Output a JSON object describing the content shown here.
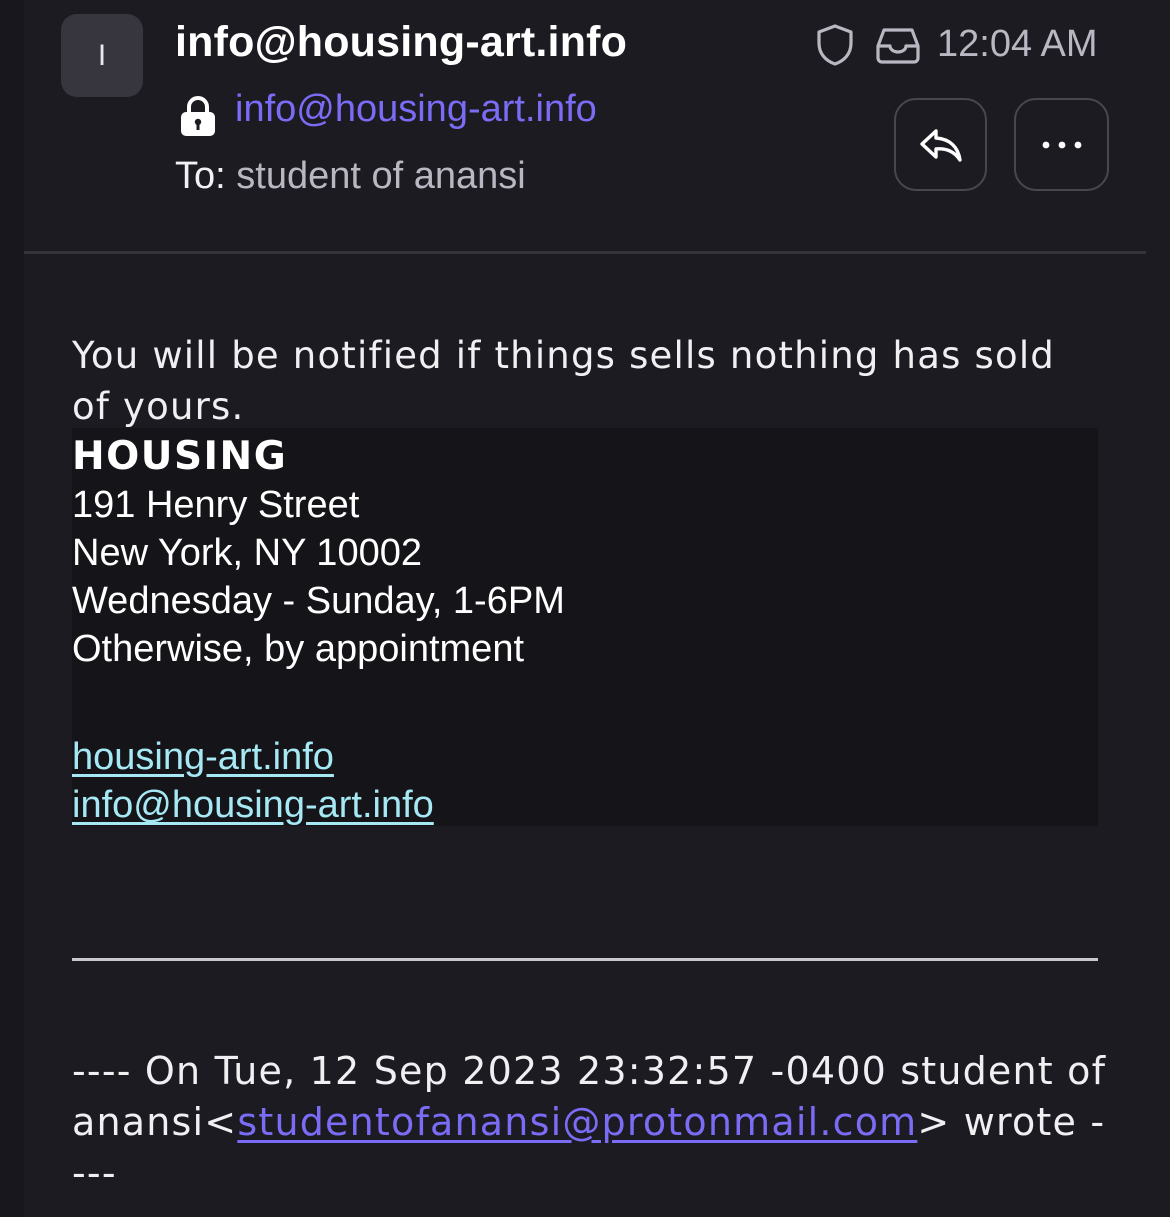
{
  "header": {
    "avatar_initial": "I",
    "sender_name": "info@housing-art.info",
    "sender_address": "info@housing-art.info",
    "to_label": "To:",
    "to_value": "student of anansi",
    "time": "12:04 AM",
    "icons": {
      "lock": "lock-icon",
      "shield": "shield-icon",
      "folder": "inbox-tray-icon",
      "reply": "reply-icon",
      "more": "more-icon"
    }
  },
  "body": {
    "paragraph": "You will be notified if things sells nothing has sold of yours.",
    "signature": {
      "name": "HOUSING",
      "street": "191 Henry Street",
      "city": "New York, NY 10002",
      "hours": "Wednesday - Sunday, 1-6PM",
      "note": "Otherwise, by appointment",
      "website": "housing-art.info",
      "email": "info@housing-art.info"
    },
    "quote": {
      "prefix": "---- On Tue, 12 Sep 2023 23:32:57 -0400 student of anansi<",
      "email": "studentofanansi@protonmail.com",
      "suffix": "> wrote ----"
    }
  },
  "colors": {
    "background": "#1c1b22",
    "accent_link": "#7b6cf6",
    "signature_link": "#a6e9f5",
    "signature_bg": "#151519"
  }
}
